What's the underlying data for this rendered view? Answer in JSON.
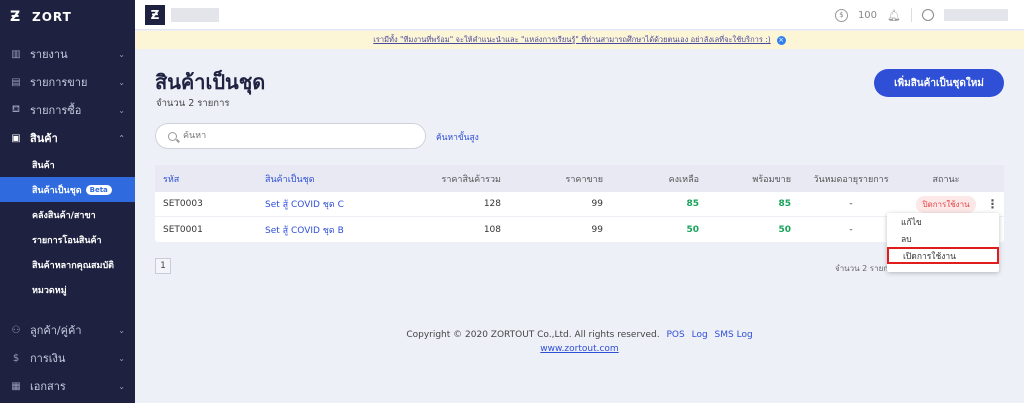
{
  "sidebar": {
    "logo_text": "ZORT",
    "items": [
      {
        "icon": "chart-icon",
        "label": "รายงาน"
      },
      {
        "icon": "clipboard-icon",
        "label": "รายการขาย"
      },
      {
        "icon": "basket-icon",
        "label": "รายการซื้อ"
      },
      {
        "icon": "box-icon",
        "label": "สินค้า"
      }
    ],
    "sub_items": [
      "สินค้า",
      "สินค้าเป็นชุด",
      "คลังสินค้า/สาขา",
      "รายการโอนสินค้า",
      "สินค้าหลากคุณสมบัติ",
      "หมวดหมู่"
    ],
    "beta": "Beta",
    "bottom_items": [
      {
        "icon": "users-icon",
        "label": "ลูกค้า/คู่ค้า"
      },
      {
        "icon": "dollar-icon",
        "label": "การเงิน"
      },
      {
        "icon": "document-icon",
        "label": "เอกสาร"
      }
    ]
  },
  "topbar": {
    "coins": "100"
  },
  "banner": {
    "text": "เรามีทั้ง \"ทีมงานที่พร้อม\" จะให้คำแนะนำและ \"แหล่งการเรียนรู้\" ที่ท่านสามารถศึกษาได้ด้วยตนเอง อย่าลังเลที่จะใช้บริการ :)"
  },
  "page": {
    "title": "สินค้าเป็นชุด",
    "count": "จำนวน 2 รายการ",
    "add_button": "เพิ่มสินค้าเป็นชุดใหม่",
    "search_placeholder": "ค้นหา",
    "advanced_search": "ค้นหาขั้นสูง"
  },
  "table": {
    "headers": [
      "รหัส",
      "สินค้าเป็นชุด",
      "ราคาสินค้ารวม",
      "ราคาขาย",
      "คงเหลือ",
      "พร้อมขาย",
      "วันหมดอายุรายการ",
      "สถานะ"
    ],
    "rows": [
      {
        "sku": "SET0003",
        "name": "Set สู้ COVID ชุด C",
        "cost": "128",
        "price": "99",
        "remaining": "85",
        "available": "85",
        "expiry": "-",
        "status": "ปิดการใช้งาน"
      },
      {
        "sku": "SET0001",
        "name": "Set สู้ COVID ชุด B",
        "cost": "108",
        "price": "99",
        "remaining": "50",
        "available": "50",
        "expiry": "-"
      }
    ]
  },
  "pager": {
    "page": "1",
    "count": "จำนวน 2 รายการ"
  },
  "dropdown": {
    "items": [
      "แก้ไข",
      "ลบ",
      "เปิดการใช้งาน"
    ]
  },
  "footer": {
    "copyright": "Copyright © 2020 ZORTOUT Co.,Ltd. All rights reserved.",
    "links": [
      "POS",
      "Log",
      "SMS Log"
    ],
    "site": "www.zortout.com"
  }
}
